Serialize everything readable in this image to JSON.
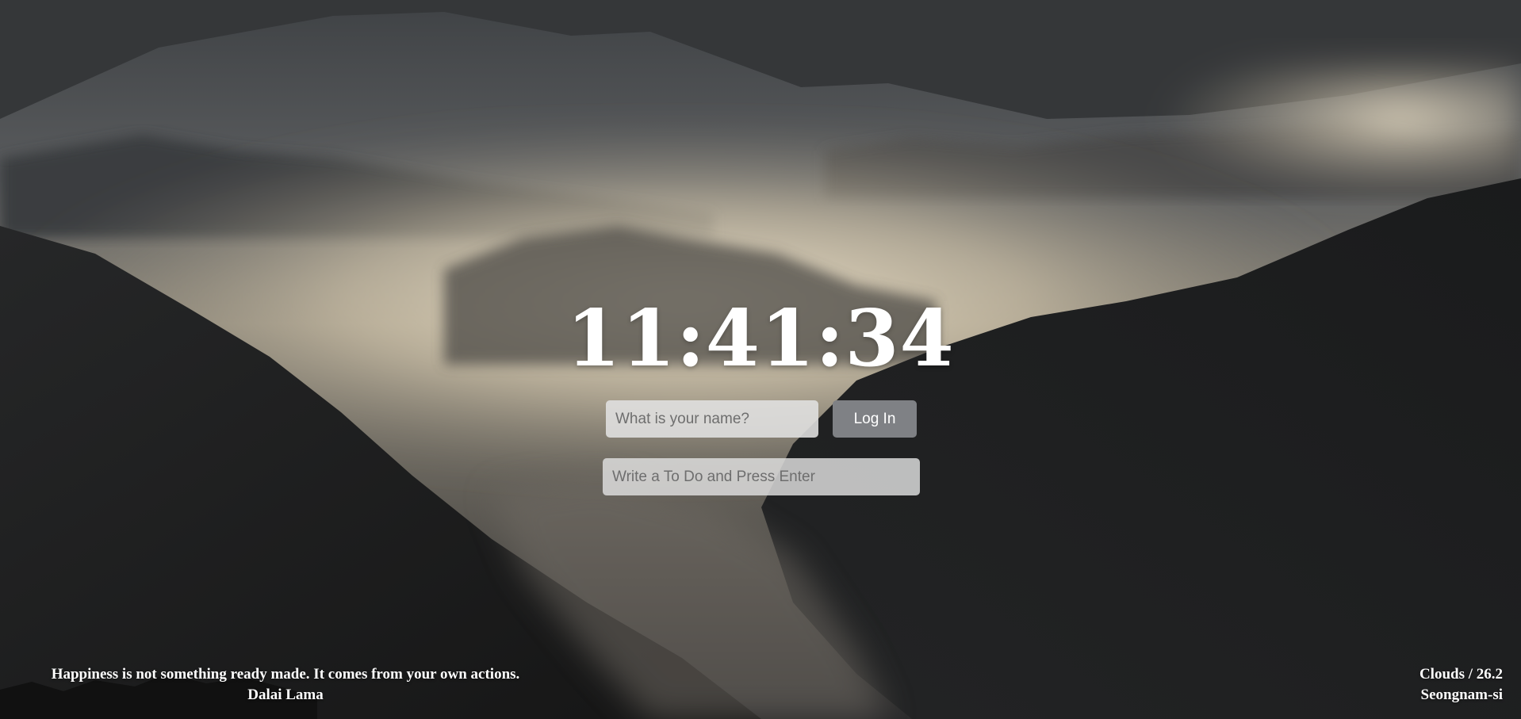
{
  "clock": {
    "time": "11:41:34"
  },
  "login": {
    "name_placeholder": "What is your name?",
    "button_label": "Log In"
  },
  "todo": {
    "placeholder": "Write a To Do and Press Enter"
  },
  "quote": {
    "text": "Happiness is not something ready made. It comes from your own actions.",
    "author": "Dalai Lama"
  },
  "weather": {
    "condition_temp": "Clouds / 26.2",
    "city": "Seongnam-si"
  },
  "background": {
    "scene": "misty-mountains-photo",
    "sky_color": "#4b4e52",
    "fog_color": "#e8dcc2",
    "mountain_color": "#1c1d1e"
  }
}
